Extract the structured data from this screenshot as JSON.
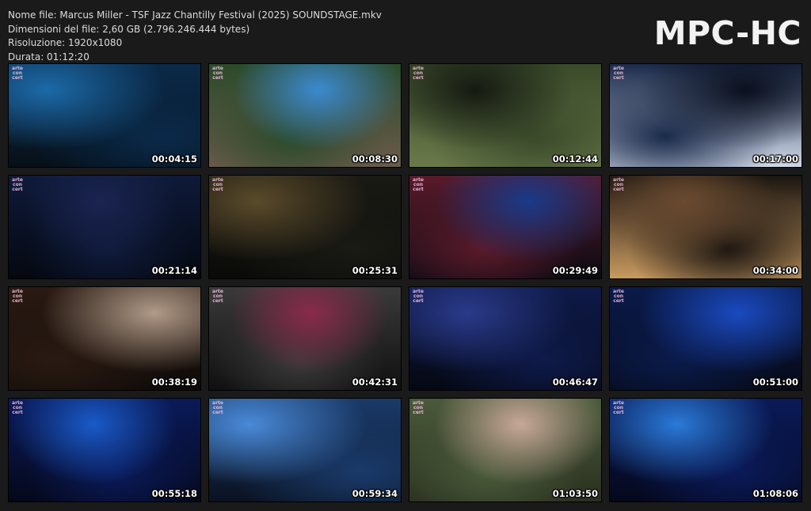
{
  "file_info": {
    "name": "Nome file: Marcus Miller - TSF Jazz Chantilly Festival (2025) SOUNDSTAGE.mkv",
    "size": "Dimensioni del file: 2,60 GB (2.796.246.444 bytes)",
    "resolution": "Risoluzione: 1920x1080",
    "duration": "Durata: 01:12:20"
  },
  "logo": "MPC-HC",
  "watermark_text": "arte concert",
  "thumbnails": [
    {
      "time": "00:04:15",
      "palette": [
        "#0a2a4a",
        "#1c6aa8",
        "#071018"
      ]
    },
    {
      "time": "00:08:30",
      "palette": [
        "#2a4a2a",
        "#3a8ad0",
        "#6a5a4a"
      ]
    },
    {
      "time": "00:12:44",
      "palette": [
        "#3a4a2a",
        "#151a12",
        "#6a7a4a"
      ]
    },
    {
      "time": "00:17:00",
      "palette": [
        "#1a2a4a",
        "#0a0f1e",
        "#d0d8e8"
      ]
    },
    {
      "time": "00:21:14",
      "palette": [
        "#0e1a3a",
        "#1a2450",
        "#050810"
      ]
    },
    {
      "time": "00:25:31",
      "palette": [
        "#1a1a14",
        "#5a4a2a",
        "#0a0a08"
      ]
    },
    {
      "time": "00:29:49",
      "palette": [
        "#5a1a2a",
        "#1a3a8a",
        "#0a0a12"
      ]
    },
    {
      "time": "00:34:00",
      "palette": [
        "#1a1410",
        "#6a4a30",
        "#c89a60"
      ]
    },
    {
      "time": "00:38:19",
      "palette": [
        "#2a1a12",
        "#b09a88",
        "#0e0a08"
      ]
    },
    {
      "time": "00:42:31",
      "palette": [
        "#3a3a3a",
        "#8a2a4a",
        "#101010"
      ]
    },
    {
      "time": "00:46:47",
      "palette": [
        "#0e1a4a",
        "#2a3a8a",
        "#050812"
      ]
    },
    {
      "time": "00:51:00",
      "palette": [
        "#0a1a4a",
        "#1a4ac0",
        "#060a18"
      ]
    },
    {
      "time": "00:55:18",
      "palette": [
        "#0a1a5a",
        "#1a5ac8",
        "#05081a"
      ]
    },
    {
      "time": "00:59:34",
      "palette": [
        "#1a3a6a",
        "#4a8ad8",
        "#0a1220"
      ]
    },
    {
      "time": "01:03:50",
      "palette": [
        "#4a5a3a",
        "#c8a898",
        "#2a3020"
      ]
    },
    {
      "time": "01:08:06",
      "palette": [
        "#0a1a5a",
        "#2a7ad8",
        "#05081a"
      ]
    }
  ]
}
